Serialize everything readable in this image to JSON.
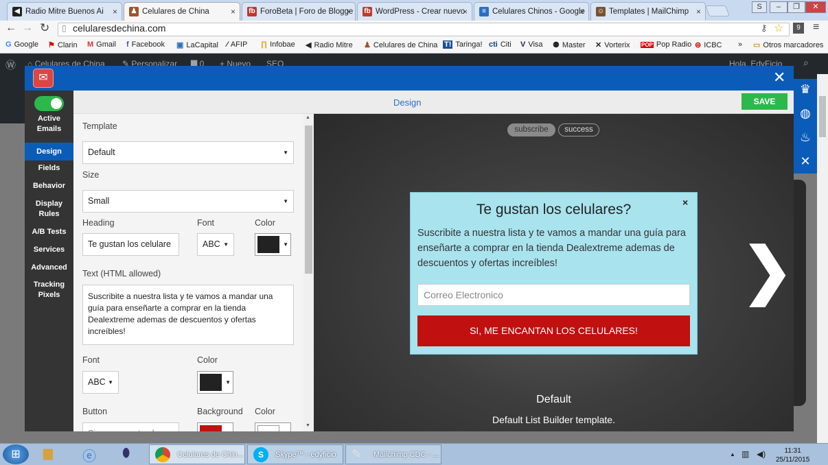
{
  "browser": {
    "tabs": [
      {
        "title": "Radio Mitre Buenos Ai",
        "icon": "speaker-icon",
        "color": "#222"
      },
      {
        "title": "Celulares de China",
        "icon": "figure-icon",
        "color": "#a0522d"
      },
      {
        "title": "ForoBeta | Foro de Blogge",
        "icon": "fb-icon",
        "color": "#c0392b"
      },
      {
        "title": "WordPress - Crear nuevo",
        "icon": "fb-icon",
        "color": "#c0392b"
      },
      {
        "title": "Celulares Chinos - Google",
        "icon": "doc-icon",
        "color": "#2a6fc4"
      },
      {
        "title": "Templates | MailChimp",
        "icon": "chimp-icon",
        "color": "#7a5230"
      }
    ],
    "url": "celularesdechina.com",
    "bookmarks": [
      "Google",
      "Clarin",
      "Gmail",
      "Facebook",
      "LaCapital",
      "AFIP",
      "Infobae",
      "Radio Mitre",
      "Celulares de China",
      "Taringa!",
      "Citi",
      "Visa",
      "Master",
      "Vorterix",
      "Pop Radio",
      "ICBC",
      "»",
      "Otros marcadores"
    ]
  },
  "wpbar": {
    "site": "Celulares de China",
    "customize": "Personalizar",
    "comments": "0",
    "new": "Nuevo",
    "seo": "SEO",
    "greeting": "Hola, EdyFicio"
  },
  "modal": {
    "title": "Design",
    "save_label": "SAVE",
    "nav": [
      {
        "label": "Active Emails"
      },
      {
        "label": "Design"
      },
      {
        "label": "Fields"
      },
      {
        "label": "Behavior"
      },
      {
        "label": "Display Rules"
      },
      {
        "label": "A/B Tests"
      },
      {
        "label": "Services"
      },
      {
        "label": "Advanced"
      },
      {
        "label": "Tracking Pixels"
      }
    ],
    "form": {
      "template_label": "Template",
      "template_value": "Default",
      "size_label": "Size",
      "size_value": "Small",
      "heading_label": "Heading",
      "heading_value": "Te gustan los celulare",
      "font_label": "Font",
      "font_value": "ABC",
      "color_label": "Color",
      "text_label": "Text (HTML allowed)",
      "text_value": "Suscribite a nuestra lista y te vamos a mandar una guía para enseñarte a comprar en la tienda Dealextreme ademas de descuentos y ofertas increíbles!",
      "font2_label": "Font",
      "font2_value": "ABC",
      "color2_label": "Color",
      "button_label": "Button",
      "background_label": "Background",
      "color3_label": "Color",
      "button_value": "Si, me encantan los"
    },
    "colors": {
      "heading": "#222222",
      "text": "#222222",
      "button_bg": "#c0100f",
      "button_color": "#ffffff",
      "accent": "#0b5cb8",
      "save": "#2db84c"
    },
    "preview": {
      "pill_subscribe": "subscribe",
      "pill_success": "success",
      "popup_title": "Te gustan los celulares?",
      "popup_text": "Suscribite a nuestra lista y te vamos a mandar una guía para enseñarte a comprar en la tienda Dealextreme ademas de descuentos y ofertas increíbles!",
      "email_placeholder": "Correo Electronico",
      "button_text": "SI, ME ENCANTAN LOS CELULARES!",
      "close": "×",
      "template_name": "Default",
      "template_desc": "Default List Builder template."
    }
  },
  "taskbar": {
    "tasks": [
      "Celulares de Chin...",
      "Skype™ - edyficio",
      "Mailchimp CDC - ..."
    ],
    "time": "11:31",
    "date": "25/11/2015"
  }
}
